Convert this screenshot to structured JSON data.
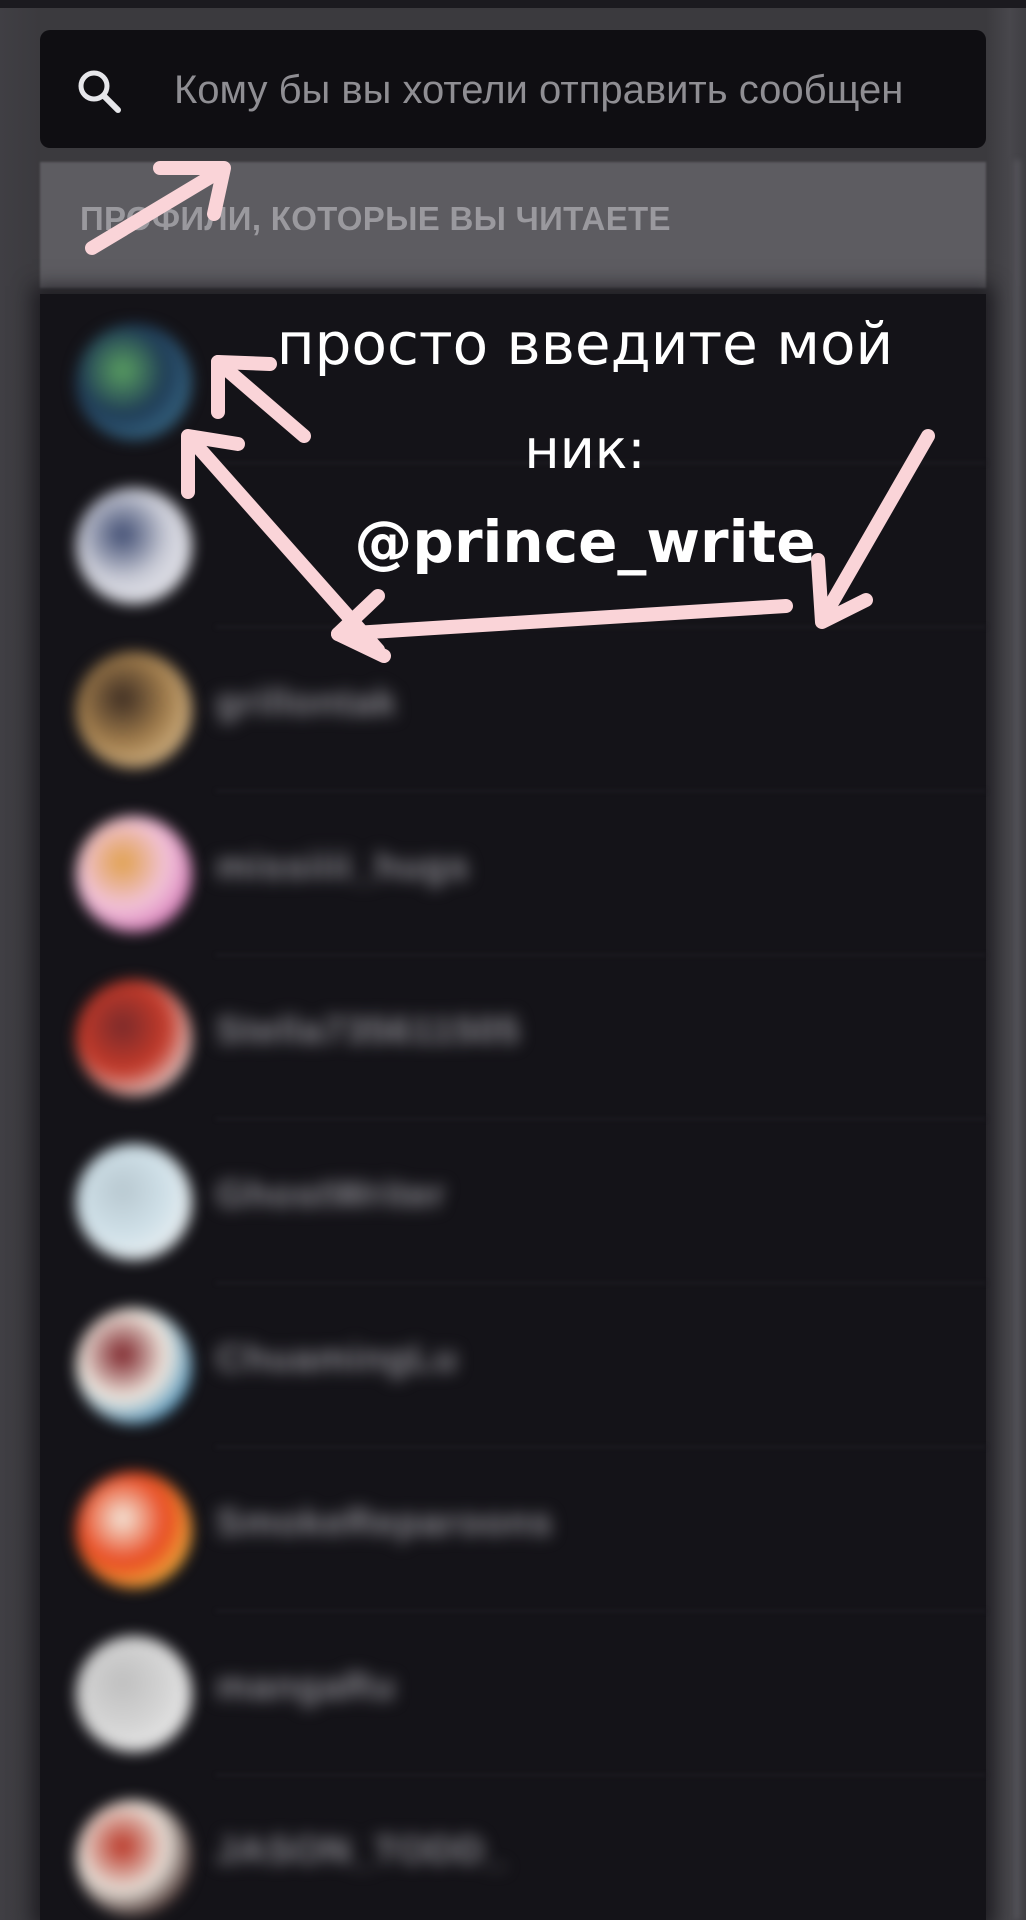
{
  "search": {
    "placeholder": "Кому бы вы хотели отправить сообщен",
    "icon": "search-icon"
  },
  "section": {
    "title": "ПРОФИЛИ, КОТОРЫЕ ВЫ ЧИТАЕТЕ"
  },
  "overlay": {
    "line1": "просто введите мой",
    "line2": "ник:",
    "handle": "@prince_write",
    "arrow_color": "#fad4d8"
  },
  "profiles": [
    {
      "username": "",
      "avatar_colors": [
        "#3a6d8a",
        "#1f3b56",
        "#5aa060"
      ]
    },
    {
      "username": "",
      "avatar_colors": [
        "#e8e8ee",
        "#c9cbd6",
        "#3d4a70"
      ]
    },
    {
      "username": "grillontak",
      "avatar_colors": [
        "#d8b98a",
        "#a07c4c",
        "#3d2d22"
      ]
    },
    {
      "username": "missiiii_hugs",
      "avatar_colors": [
        "#d676b8",
        "#f1c3d8",
        "#e0a04a"
      ]
    },
    {
      "username": "Stella735611505",
      "avatar_colors": [
        "#e7e3e3",
        "#c33a2a",
        "#7a2a2a"
      ]
    },
    {
      "username": "GhostWriter",
      "avatar_colors": [
        "#eef2f4",
        "#cfe0e8",
        "#b8c8d0"
      ]
    },
    {
      "username": "ChuamingLu",
      "avatar_colors": [
        "#3a8ab8",
        "#f0e9e0",
        "#7a1f25"
      ]
    },
    {
      "username": "SmokeReparoons",
      "avatar_colors": [
        "#f0c040",
        "#e84820",
        "#f4ece0"
      ]
    },
    {
      "username": "mangaRu",
      "avatar_colors": [
        "#eaeaea",
        "#d4d4d4",
        "#bfbfbf"
      ]
    },
    {
      "username": "JASON_TODD_",
      "avatar_colors": [
        "#2a1412",
        "#e8e0d8",
        "#b83020"
      ]
    }
  ]
}
